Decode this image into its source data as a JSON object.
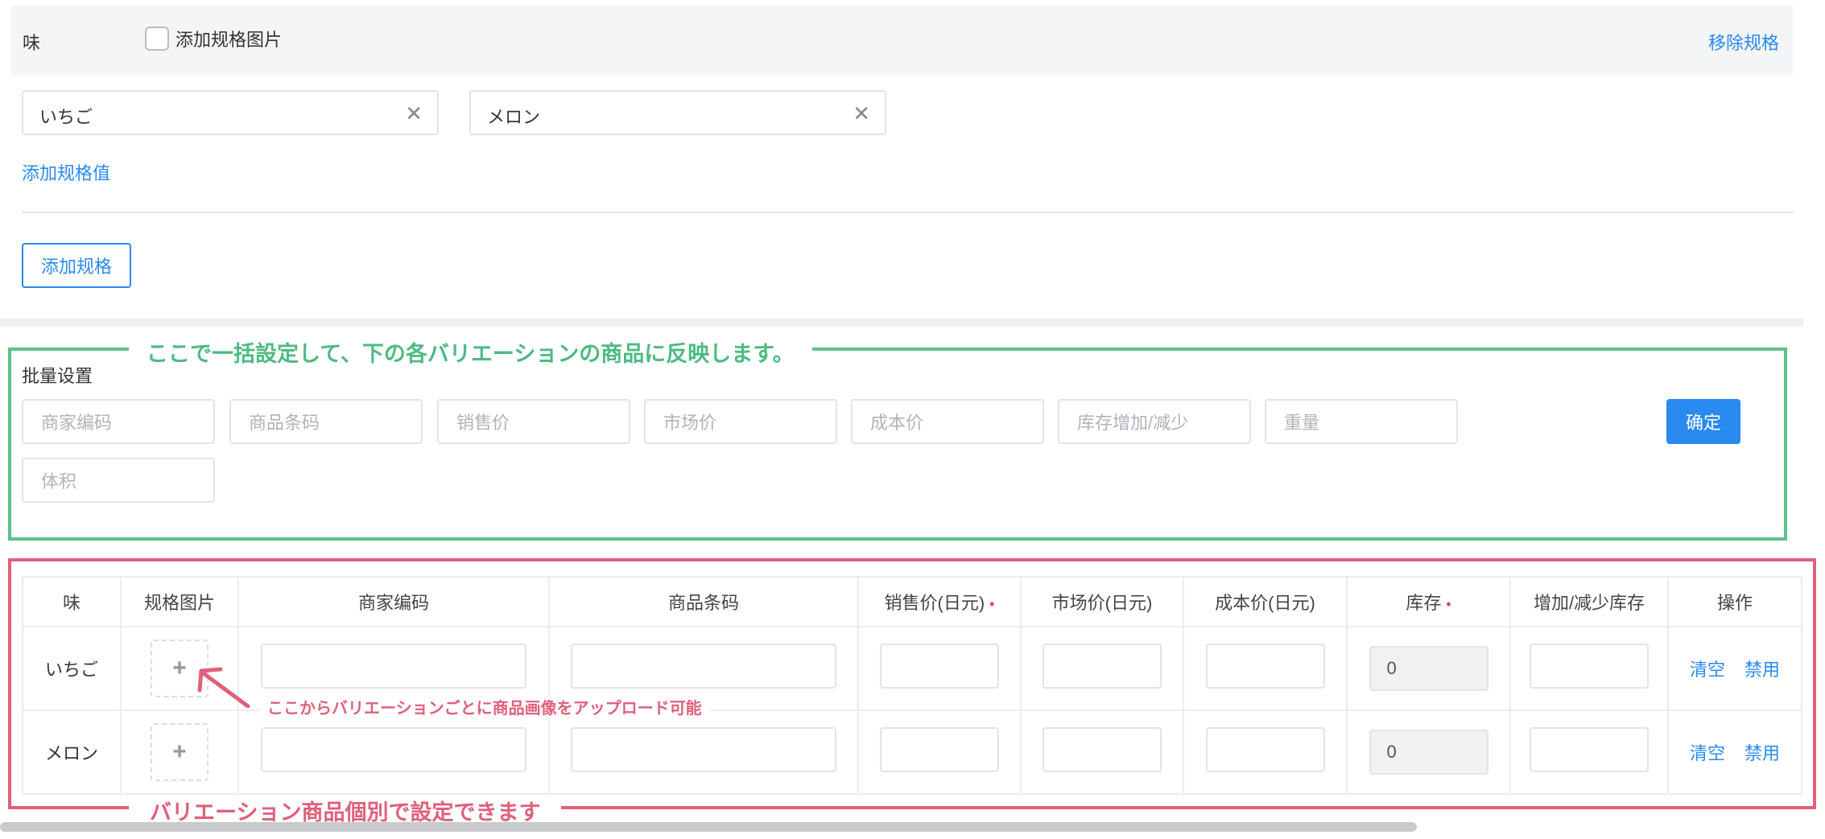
{
  "spec": {
    "name": "味",
    "add_image_label": "添加规格图片",
    "remove_label": "移除规格",
    "values": [
      "いちご",
      "メロン"
    ],
    "add_value_label": "添加规格值",
    "add_spec_label": "添加规格"
  },
  "batch": {
    "annotation": "ここで一括設定して、下の各バリエーションの商品に反映します。",
    "title": "批量设置",
    "placeholders": [
      "商家编码",
      "商品条码",
      "销售价",
      "市场价",
      "成本价",
      "库存增加/减少",
      "重量",
      "体积"
    ],
    "confirm_label": "确定"
  },
  "table": {
    "headers": [
      "味",
      "规格图片",
      "商家编码",
      "商品条码",
      "销售价(日元)",
      "市场价(日元)",
      "成本价(日元)",
      "库存",
      "增加/减少库存",
      "操作"
    ],
    "required_mark": "•",
    "rows": [
      {
        "flavor": "いちご",
        "stock": "0"
      },
      {
        "flavor": "メロン",
        "stock": "0"
      }
    ],
    "upload_symbol": "+",
    "clear_label": "清空",
    "disable_label": "禁用",
    "upload_annotation": "ここからバリエーションごとに商品画像をアップロード可能",
    "annotation": "バリエーション商品個別で設定できます"
  },
  "colors": {
    "accent": "#2a8af0",
    "green_annotation": "#5bc28c",
    "red_annotation": "#e0607a"
  }
}
